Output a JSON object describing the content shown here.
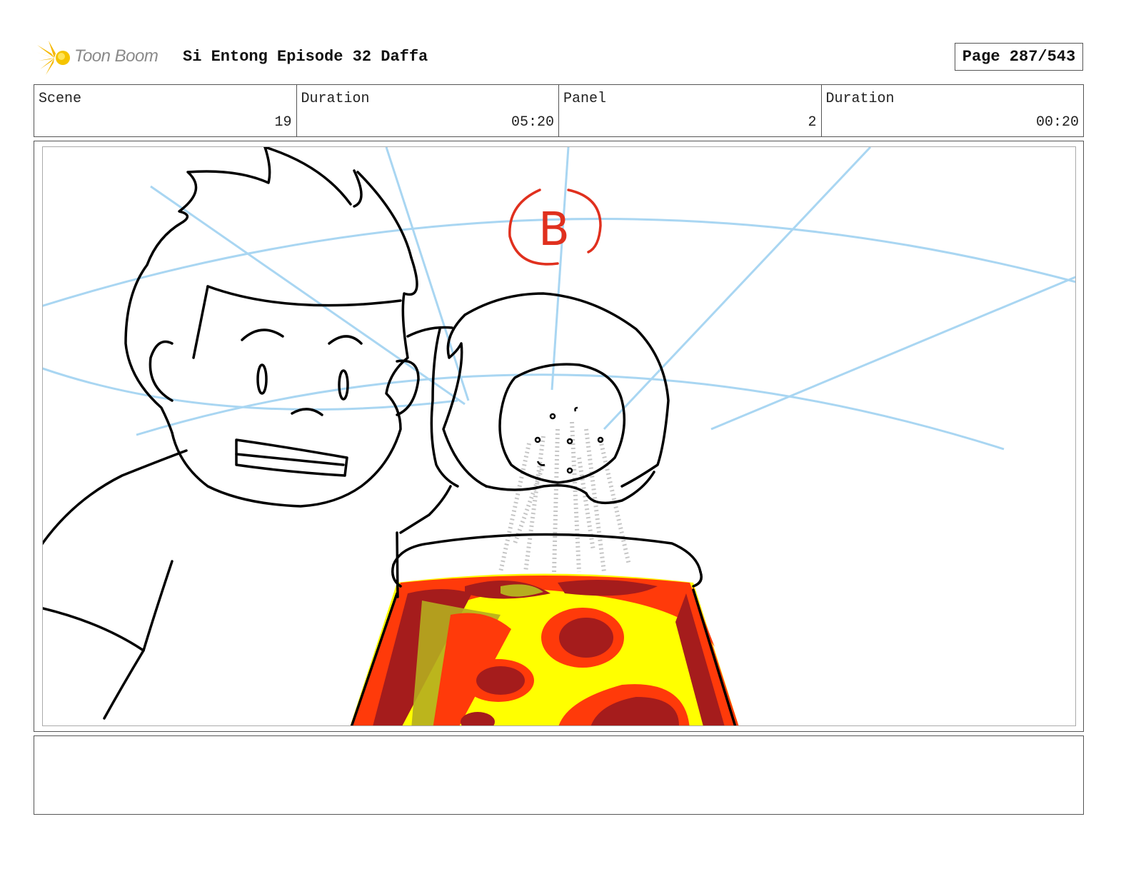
{
  "header": {
    "logo_text": "Toon Boom",
    "title": "Si Entong Episode 32 Daffa",
    "page_label": "Page 287/543"
  },
  "info": {
    "scene_label": "Scene",
    "scene_value": "19",
    "duration_label": "Duration",
    "duration_value": "05:20",
    "panel_label": "Panel",
    "panel_value": "2",
    "panel_duration_label": "Duration",
    "panel_duration_value": "00:20"
  },
  "panel": {
    "annotation": "B",
    "colors": {
      "guide_lines": "#a9d6f2",
      "annotation": "#e0301e",
      "lava_dark": "#a51c1c",
      "lava_orange": "#ff3a0a",
      "lava_yellow": "#ffff00",
      "lava_olive": "#b5ad1f"
    }
  },
  "notes": {
    "text": ""
  }
}
